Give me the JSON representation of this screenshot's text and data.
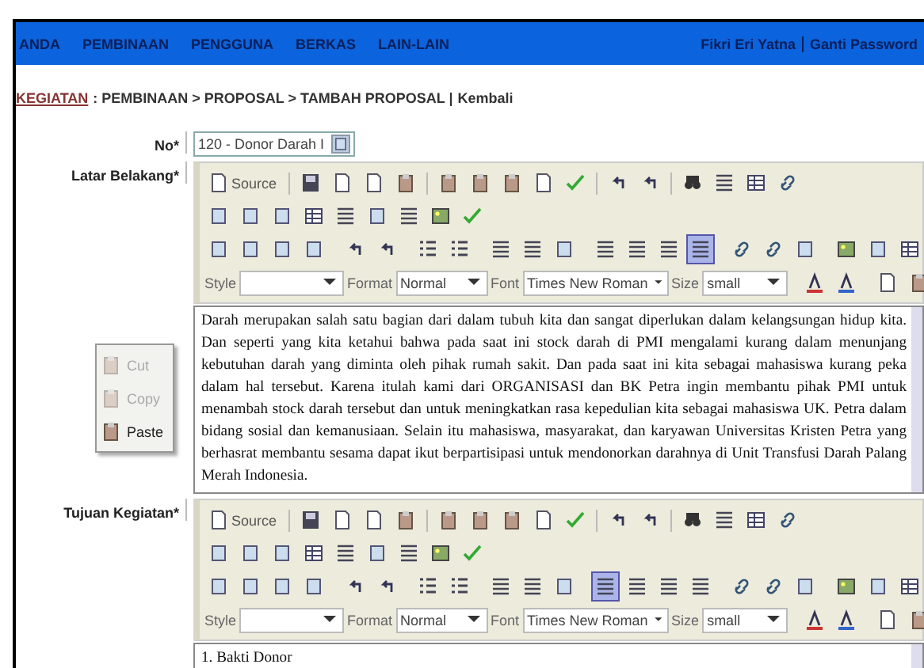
{
  "nav": {
    "items": [
      "ANDA",
      "PEMBINAAN",
      "PENGGUNA",
      "BERKAS",
      "LAIN-LAIN"
    ],
    "user_links": [
      "Fikri Eri Yatna",
      "Ganti Password"
    ]
  },
  "breadcrumb": {
    "root": "KEGIATAN",
    "trail": ": PEMBINAAN > PROPOSAL > TAMBAH PROPOSAL |",
    "back": "Kembali"
  },
  "fields": [
    {
      "kind": "select",
      "label": "No*",
      "value": "120 - Donor Darah I"
    },
    {
      "kind": "editor",
      "label": "Latar Belakang*",
      "toolbar": {
        "source": "Source",
        "style_label": "Style",
        "format_label": "Format",
        "format_value": "Normal",
        "font_label": "Font",
        "font_value": "Times New Roman",
        "size_label": "Size",
        "size_value": "small",
        "align_buttons": [
          {
            "selected": false
          },
          {
            "selected": false
          },
          {
            "selected": false
          },
          {
            "selected": true
          }
        ]
      },
      "content": "Darah merupakan salah satu bagian dari dalam tubuh kita dan sangat diperlukan dalam kelangsungan hidup kita. Dan seperti yang kita ketahui bahwa pada saat ini stock darah di PMI mengalami kurang dalam menunjang kebutuhan darah yang diminta oleh pihak rumah sakit. Dan pada saat ini kita sebagai mahasiswa kurang peka dalam hal tersebut. Karena itulah kami dari ORGANISASI dan BK Petra ingin membantu pihak PMI untuk menambah stock darah tersebut dan untuk meningkatkan rasa kepedulian kita sebagai mahasiswa UK. Petra dalam bidang sosial dan kemanusiaan. Selain itu mahasiswa, masyarakat, dan karyawan Universitas Kristen Petra yang berhasrat membantu sesama dapat ikut berpartisipasi untuk mendonorkan darahnya di Unit Transfusi Darah Palang Merah Indonesia.",
      "context_menu": [
        {
          "label": "Cut",
          "disabled": true
        },
        {
          "label": "Copy",
          "disabled": true
        },
        {
          "label": "Paste",
          "disabled": false
        }
      ]
    },
    {
      "kind": "editor",
      "label": "Tujuan Kegiatan*",
      "toolbar": {
        "source": "Source",
        "style_label": "Style",
        "format_label": "Format",
        "format_value": "Normal",
        "font_label": "Font",
        "font_value": "Times New Roman",
        "size_label": "Size",
        "size_value": "small",
        "align_buttons": [
          {
            "selected": true
          },
          {
            "selected": false
          },
          {
            "selected": false
          },
          {
            "selected": false
          }
        ]
      },
      "content": "1. Bakti Donor"
    }
  ]
}
